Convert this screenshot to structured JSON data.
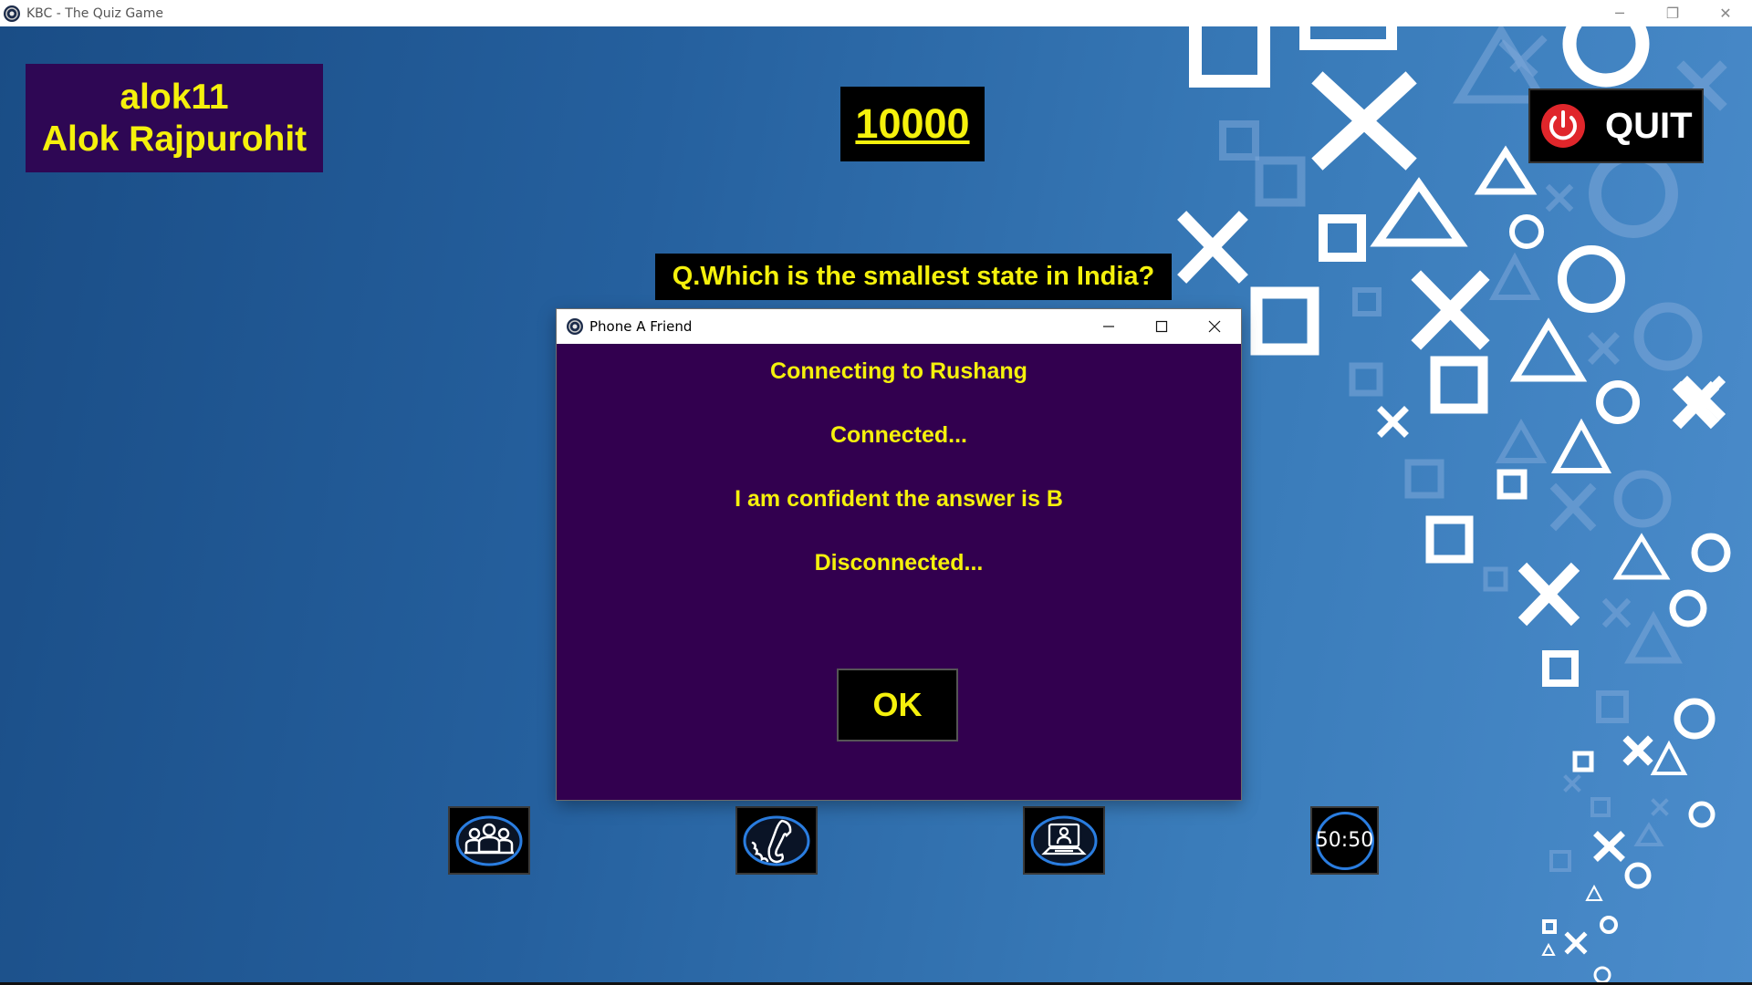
{
  "window": {
    "title": "KBC - The Quiz Game",
    "controls": [
      "minimize",
      "restore",
      "close"
    ]
  },
  "player": {
    "username": "alok11",
    "full_name": "Alok Rajpurohit"
  },
  "score": "10000",
  "quit": {
    "label": "QUIT",
    "icon": "power-icon"
  },
  "question": {
    "text": "Q.Which is the smallest state in India?"
  },
  "lifelines": [
    {
      "name": "audience-poll",
      "icon": "audience-icon"
    },
    {
      "name": "phone-a-friend",
      "icon": "phone-icon"
    },
    {
      "name": "ask-the-expert",
      "icon": "expert-laptop-icon"
    },
    {
      "name": "fifty-fifty",
      "label": "50:50"
    }
  ],
  "dialog": {
    "title": "Phone A Friend",
    "lines": [
      "Connecting to Rushang",
      "Connected...",
      "I am confident the answer is B",
      "Disconnected..."
    ],
    "ok_label": "OK"
  },
  "colors": {
    "accent_yellow": "#f5f10c",
    "panel_purple": "#2e0754",
    "dialog_purple": "#32004f",
    "background_blue": "#25609e",
    "quit_red": "#e0262b"
  }
}
